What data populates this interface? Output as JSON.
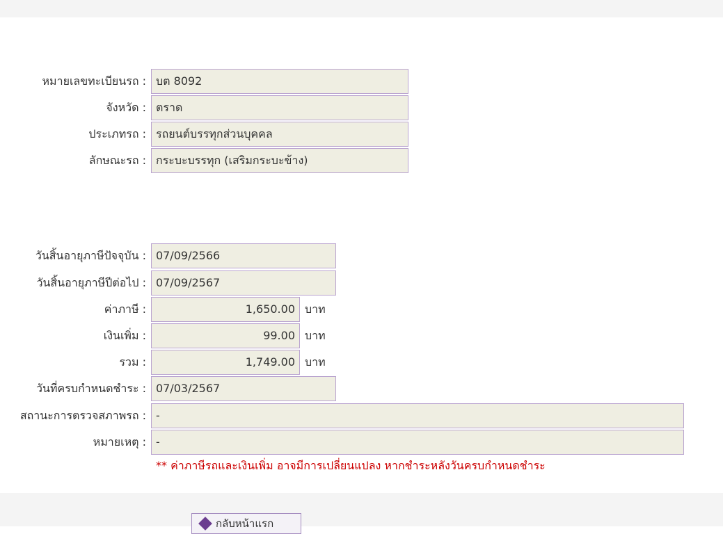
{
  "vehicle": {
    "plate_label": "หมายเลขทะเบียนรถ :",
    "plate_value": "บต 8092",
    "province_label": "จังหวัด :",
    "province_value": "ตราด",
    "type_label": "ประเภทรถ :",
    "type_value": "รถยนต์บรรทุกส่วนบุคคล",
    "body_label": "ลักษณะรถ :",
    "body_value": "กระบะบรรทุก (เสริมกระบะข้าง)"
  },
  "tax": {
    "current_expiry_label": "วันสิ้นอายุภาษีปัจจุบัน :",
    "current_expiry_value": "07/09/2566",
    "next_expiry_label": "วันสิ้นอายุภาษีปีต่อไป :",
    "next_expiry_value": "07/09/2567",
    "tax_label": "ค่าภาษี :",
    "tax_value": "1,650.00",
    "surcharge_label": "เงินเพิ่ม :",
    "surcharge_value": "99.00",
    "total_label": "รวม :",
    "total_value": "1,749.00",
    "currency_unit": "บาท",
    "due_date_label": "วันที่ครบกำหนดชำระ :",
    "due_date_value": "07/03/2567",
    "inspection_label": "สถานะการตรวจสภาพรถ :",
    "inspection_value": "-",
    "remark_label": "หมายเหตุ :",
    "remark_value": "-"
  },
  "note": "** ค่าภาษีรถและเงินเพิ่ม อาจมีการเปลี่ยนแปลง หากชำระหลังวันครบกำหนดชำระ",
  "back_button_label": "กลับหน้าแรก",
  "back_icon": "diamond-arrow-icon"
}
